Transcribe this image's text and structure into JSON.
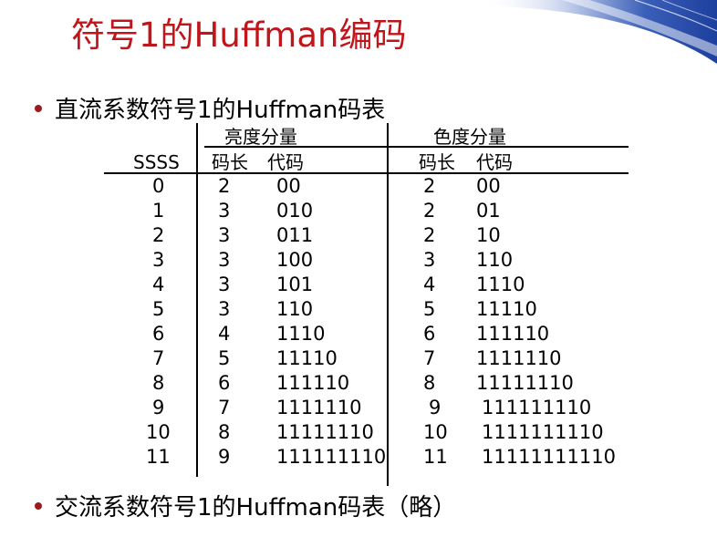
{
  "slide": {
    "title": "符号1的Huffman编码",
    "bullet1": "直流系数符号1的Huffman码表",
    "bullet2": "交流系数符号1的Huffman码表（略）"
  },
  "table": {
    "group_luma": "亮度分量",
    "group_chroma": "色度分量",
    "col_ssss": "SSSS",
    "col_len": "码长",
    "col_code": "代码",
    "rows": [
      {
        "ssss": "0",
        "luma_len": "2",
        "luma_code": "00",
        "chroma_len": "2",
        "chroma_code": "00"
      },
      {
        "ssss": "1",
        "luma_len": "3",
        "luma_code": "010",
        "chroma_len": "2",
        "chroma_code": "01"
      },
      {
        "ssss": "2",
        "luma_len": "3",
        "luma_code": "011",
        "chroma_len": "2",
        "chroma_code": "10"
      },
      {
        "ssss": "3",
        "luma_len": "3",
        "luma_code": "100",
        "chroma_len": "3",
        "chroma_code": "110"
      },
      {
        "ssss": "4",
        "luma_len": "3",
        "luma_code": "101",
        "chroma_len": "4",
        "chroma_code": "1110"
      },
      {
        "ssss": "5",
        "luma_len": "3",
        "luma_code": "110",
        "chroma_len": "5",
        "chroma_code": "11110"
      },
      {
        "ssss": "6",
        "luma_len": "4",
        "luma_code": "1110",
        "chroma_len": "6",
        "chroma_code": "111110"
      },
      {
        "ssss": "7",
        "luma_len": "5",
        "luma_code": "11110",
        "chroma_len": "7",
        "chroma_code": "1111110"
      },
      {
        "ssss": "8",
        "luma_len": "6",
        "luma_code": "111110",
        "chroma_len": "8",
        "chroma_code": "11111110"
      },
      {
        "ssss": "9",
        "luma_len": "7",
        "luma_code": "1111110",
        "chroma_len": "9",
        "chroma_code": "111111110"
      },
      {
        "ssss": "10",
        "luma_len": "8",
        "luma_code": "11111110",
        "chroma_len": "10",
        "chroma_code": "1111111110"
      },
      {
        "ssss": "11",
        "luma_len": "9",
        "luma_code": "111111110",
        "chroma_len": "11",
        "chroma_code": "11111111110"
      }
    ]
  },
  "colors": {
    "title": "#c0151b",
    "bullet": "#9b1b1f",
    "deco_blue": "#1d3f9e"
  }
}
